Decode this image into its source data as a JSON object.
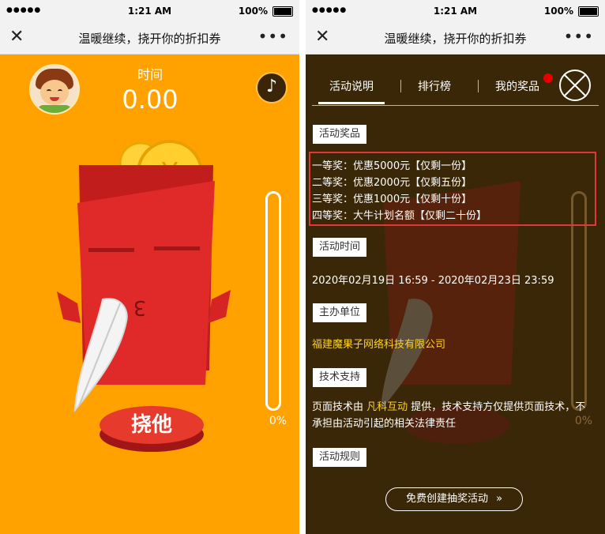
{
  "status": {
    "time": "1:21 AM",
    "battery": "100%"
  },
  "nav": {
    "title": "温暖继续，挠开你的折扣券"
  },
  "game": {
    "timer_label": "时间",
    "timer_value": "0.00",
    "envelope_mouth": "3",
    "progress_label": "0%",
    "progress_fraction": 0,
    "tap_button": "挠他"
  },
  "panel": {
    "tabs": [
      {
        "label": "活动说明"
      },
      {
        "label": "排行榜"
      },
      {
        "label": "我的奖品"
      }
    ],
    "sections": {
      "prizes": "活动奖品",
      "time": "活动时间",
      "organizer": "主办单位",
      "support": "技术支持",
      "rules": "活动规则"
    },
    "prize_lines": [
      "一等奖：优惠5000元【仅剩一份】",
      "二等奖：优惠2000元【仅剩五份】",
      "三等奖：优惠1000元【仅剩十份】",
      "四等奖：大牛计划名额【仅剩二十份】"
    ],
    "time_range": "2020年02月19日 16:59 - 2020年02月23日 23:59",
    "organizer_name": "福建魔果子网络科技有限公司",
    "support_prefix": "页面技术由 ",
    "support_link": "凡科互动",
    "support_suffix": " 提供，技术支持方仅提供页面技术，不承担由活动引起的相关法律责任",
    "create_button": "免费创建抽奖活动",
    "create_arrow": "»"
  },
  "colors": {
    "game_bg": "#ffa200",
    "overlay_bg": "#3a2708",
    "envelope_red": "#e02a2a",
    "highlight_box": "#e0373a",
    "link_yellow": "#ffd21e"
  },
  "icons": [
    "close-icon",
    "more-icon",
    "music-note-icon",
    "close-circle-icon",
    "double-chevron-right-icon"
  ]
}
